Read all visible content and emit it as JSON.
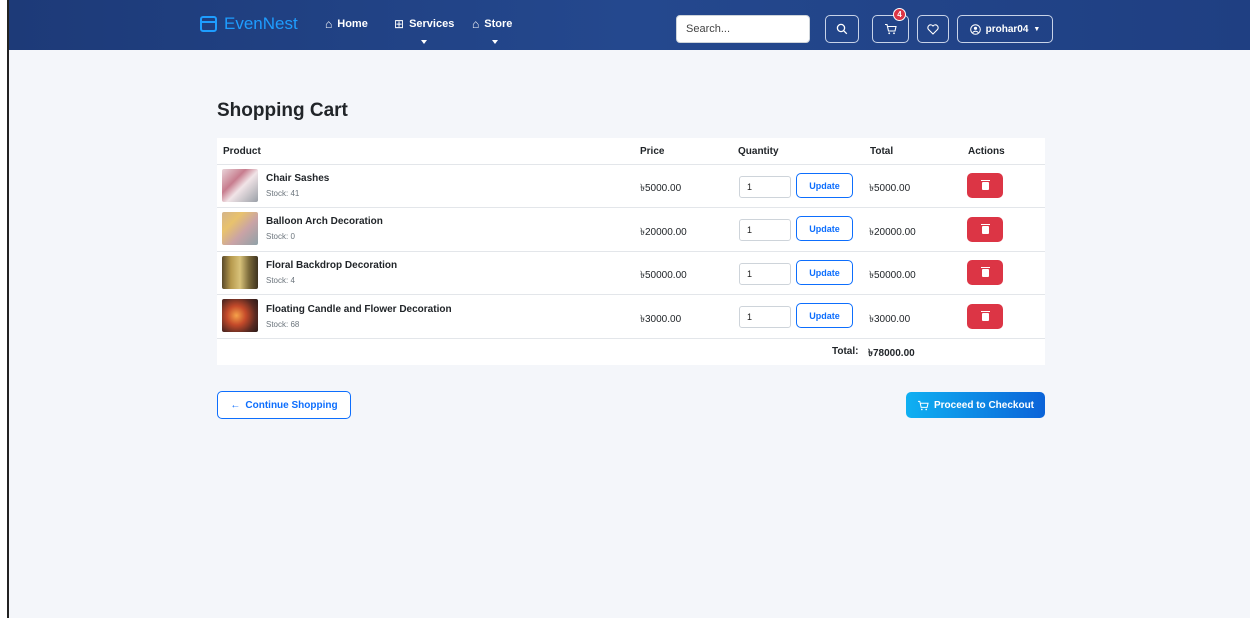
{
  "brand": {
    "name": "EvenNest"
  },
  "nav": {
    "home": "Home",
    "services": "Services",
    "store": "Store"
  },
  "search": {
    "placeholder": "Search..."
  },
  "cart": {
    "badge": "4"
  },
  "user": {
    "name": "prohar04"
  },
  "page": {
    "title": "Shopping Cart"
  },
  "table": {
    "headers": {
      "product": "Product",
      "price": "Price",
      "quantity": "Quantity",
      "total": "Total",
      "actions": "Actions"
    },
    "rows": [
      {
        "name": "Chair Sashes",
        "stock": "Stock: 41",
        "price": "৳5000.00",
        "qty": "1",
        "update": "Update",
        "total": "৳5000.00"
      },
      {
        "name": "Balloon Arch Decoration",
        "stock": "Stock: 0",
        "price": "৳20000.00",
        "qty": "1",
        "update": "Update",
        "total": "৳20000.00"
      },
      {
        "name": "Floral Backdrop Decoration",
        "stock": "Stock: 4",
        "price": "৳50000.00",
        "qty": "1",
        "update": "Update",
        "total": "৳50000.00"
      },
      {
        "name": "Floating Candle and Flower Decoration",
        "stock": "Stock: 68",
        "price": "৳3000.00",
        "qty": "1",
        "update": "Update",
        "total": "৳3000.00"
      }
    ],
    "total_label": "Total:",
    "total_value": "৳78000.00"
  },
  "actions": {
    "continue": "Continue Shopping",
    "checkout": "Proceed to Checkout"
  },
  "colors": {
    "navbar": "#24488e",
    "brand": "#1e9dff",
    "primary": "#0d6efd",
    "danger": "#dc3545",
    "background": "#f4f6fa"
  }
}
